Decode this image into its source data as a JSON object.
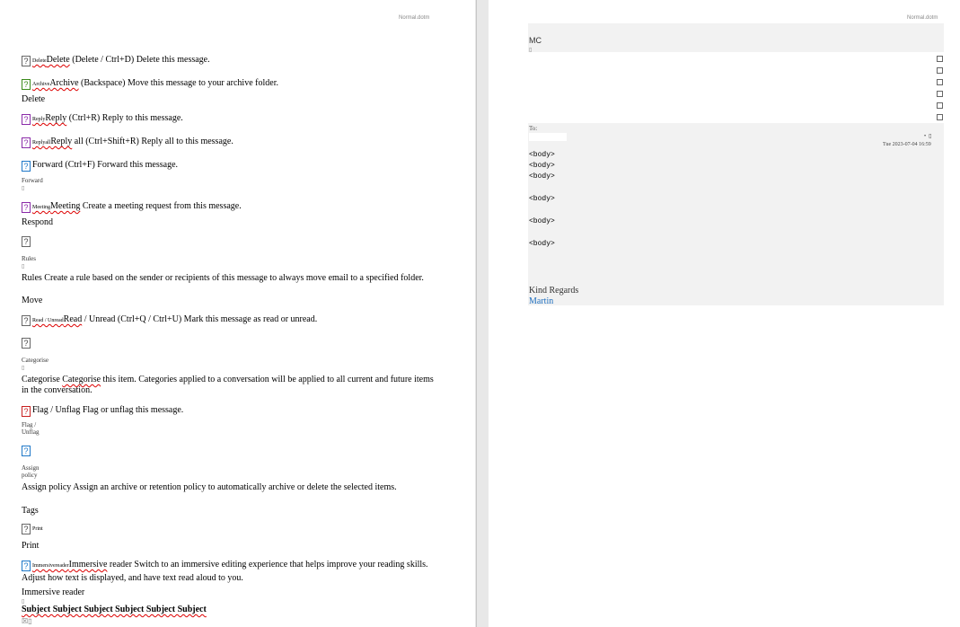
{
  "header_template": "Normal.dotm",
  "left": {
    "items": [
      {
        "small": "Delete",
        "main": "Delete",
        "rest": " (Delete / Ctrl+D) Delete this message."
      },
      {
        "small": "Archive",
        "main": "Archive",
        "rest": " (Backspace) Move this message to your archive folder."
      },
      {
        "group": "Delete"
      },
      {
        "small": "Reply",
        "main": "Reply",
        "rest": " (Ctrl+R) Reply to this message."
      },
      {
        "small": "Replyall",
        "main": "Reply",
        "rest": " all (Ctrl+Shift+R) Reply all to this message."
      },
      {
        "main": "Forward (Ctrl+F) Forward this message.",
        "sub_label": "Forward"
      },
      {
        "small": "Meeting",
        "main": "Meeting",
        "rest": " Create a meeting request from this message."
      },
      {
        "group": "Respond"
      },
      {
        "sub_label": "Rules",
        "rest": "Rules Create a rule based on the sender or recipients of this message to always move email to a specified folder."
      },
      {
        "group": "Move"
      },
      {
        "small": "Read / Unread",
        "main": "Read",
        "rest": " / Unread (Ctrl+Q / Ctrl+U) Mark this message as read or unread."
      },
      {
        "sub_label": "Categorise",
        "pre": "Categorise ",
        "main": "Categorise",
        "rest": " this item. Categories applied to a conversation will be applied to all current and future items in the conversation."
      },
      {
        "main": "Flag / Unflag Flag or unflag this message.",
        "sub_label": "Flag / Unflag"
      },
      {
        "sub_label": "Assign policy",
        "rest": "Assign policy Assign an archive or retention policy to automatically archive or delete the selected items."
      },
      {
        "group": "Tags"
      },
      {
        "small": "Print"
      },
      {
        "group": "Print"
      },
      {
        "small": "Immersivereader",
        "main": "Immersive",
        "rest": " reader Switch to an immersive editing experience that helps improve your reading skills. Adjust how text is displayed, and have text read aloud to you."
      },
      {
        "group": "Immersive reader"
      },
      {
        "subject": "Subject Subject Subject Subject Subject Subject"
      }
    ]
  },
  "right": {
    "initials": "MC",
    "to_label": "To:",
    "date": "Tue 2023-07-04 16:59",
    "body_tags": [
      "<body>",
      "<body>",
      "<body>",
      "<body>",
      "<body>",
      "<body>"
    ],
    "closing": "Kind Regards",
    "signature": "Martin"
  }
}
